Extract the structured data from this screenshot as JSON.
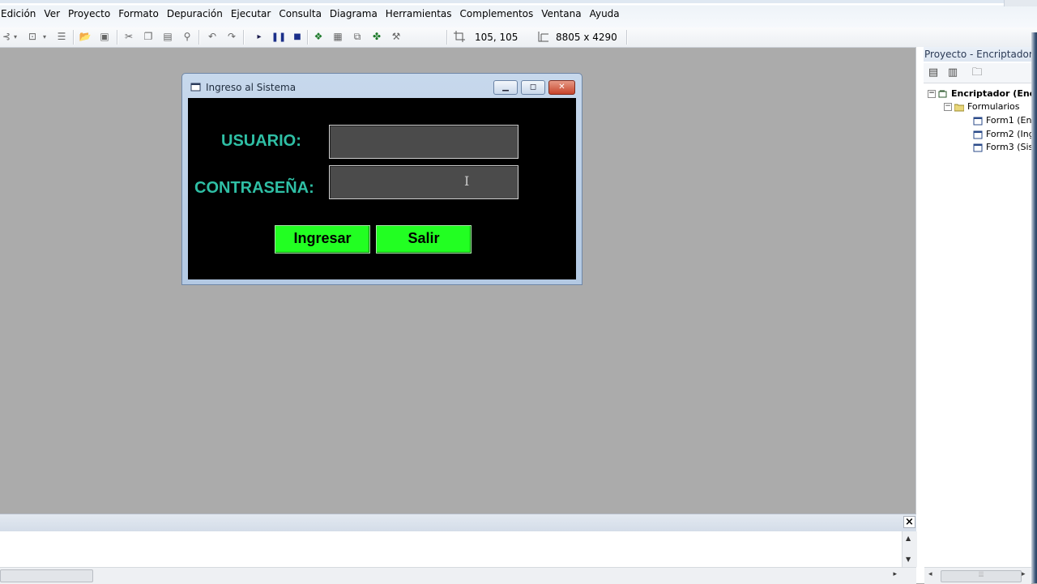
{
  "menu": {
    "items": [
      "Edición",
      "Ver",
      "Proyecto",
      "Formato",
      "Depuración",
      "Ejecutar",
      "Consulta",
      "Diagrama",
      "Herramientas",
      "Complementos",
      "Ventana",
      "Ayuda"
    ]
  },
  "toolbar": {
    "position_value": "105, 105",
    "size_value": "8805 x 4290"
  },
  "project": {
    "title": "Proyecto - Encriptador",
    "root": "Encriptador (Enc",
    "folder": "Formularios",
    "forms": [
      "Form1 (Enc",
      "Form2 (Ing",
      "Form3 (Sis"
    ]
  },
  "form": {
    "title": "Ingreso al Sistema",
    "usuario_label": "USUARIO:",
    "contrasena_label": "CONTRASEÑA:",
    "ingresar_label": "Ingresar",
    "salir_label": "Salir"
  },
  "colors": {
    "label_color": "#2fbfa5",
    "button_color": "#22ff22",
    "form_background": "#000000",
    "workspace": "#ababab"
  }
}
